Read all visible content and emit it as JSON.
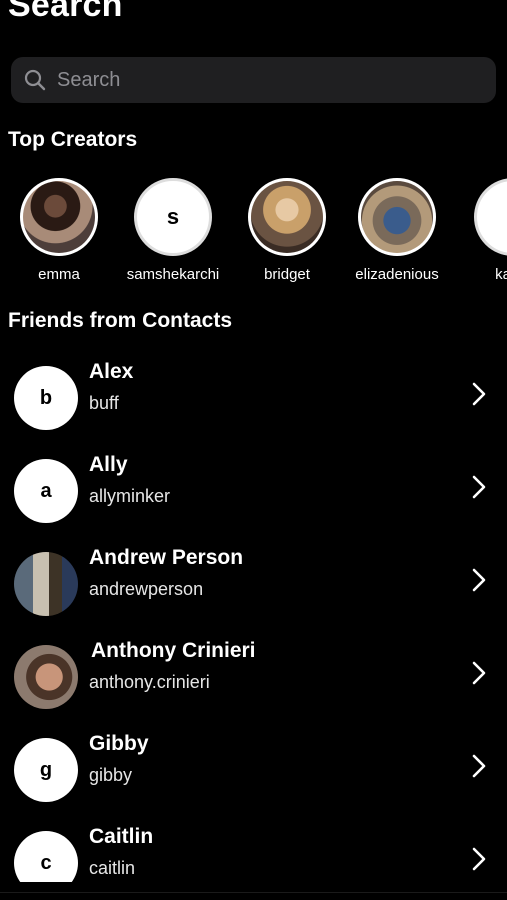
{
  "header": {
    "title": "Search"
  },
  "search": {
    "placeholder": "Search"
  },
  "top_creators": {
    "title": "Top Creators",
    "items": [
      {
        "name": "emma",
        "avatar": "photo"
      },
      {
        "name": "samshekarchi",
        "avatar": "letter",
        "letter": "s"
      },
      {
        "name": "bridget",
        "avatar": "photo"
      },
      {
        "name": "elizadenious",
        "avatar": "photo"
      },
      {
        "name": "katev",
        "avatar": "letter"
      }
    ]
  },
  "contacts": {
    "title": "Friends from Contacts",
    "items": [
      {
        "name": "Alex",
        "handle": "buff",
        "avatar": "letter",
        "letter": "b"
      },
      {
        "name": "Ally",
        "handle": "allyminker",
        "avatar": "letter",
        "letter": "a"
      },
      {
        "name": "Andrew Person",
        "handle": "andrewperson",
        "avatar": "photo"
      },
      {
        "name": "Anthony Crinieri",
        "handle": "anthony.crinieri",
        "avatar": "photo"
      },
      {
        "name": "Gibby",
        "handle": "gibby",
        "avatar": "letter",
        "letter": "g"
      },
      {
        "name": "Caitlin",
        "handle": "caitlin",
        "avatar": "letter",
        "letter": "c"
      }
    ]
  },
  "icons": {
    "search": "search-icon",
    "chevron": "chevron-right-icon"
  },
  "colors": {
    "background": "#000000",
    "search_bar": "#1f1f21",
    "placeholder": "#8e8e93",
    "text": "#ffffff"
  }
}
